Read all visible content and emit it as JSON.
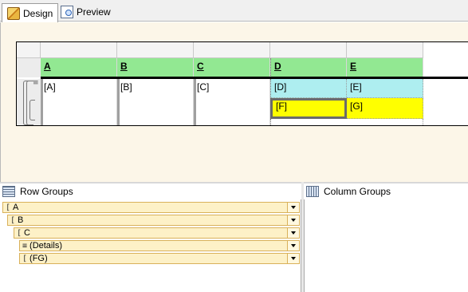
{
  "tabs": [
    {
      "label": "Design",
      "icon": "design-icon",
      "active": true
    },
    {
      "label": "Preview",
      "icon": "preview-icon",
      "active": false
    }
  ],
  "tablix": {
    "headers": [
      "A",
      "B",
      "C",
      "D",
      "E"
    ],
    "detail_row": [
      "[A]",
      "[B]",
      "[C]",
      "[D]",
      "[E]"
    ],
    "group_row": [
      "[F]",
      "[G]"
    ]
  },
  "row_groups": {
    "title": "Row Groups",
    "items": [
      {
        "label": "A",
        "icon": "["
      },
      {
        "label": "B",
        "icon": "["
      },
      {
        "label": "C",
        "icon": "["
      },
      {
        "label": "(Details)",
        "icon": "≡"
      },
      {
        "label": "(FG)",
        "icon": "["
      }
    ]
  },
  "column_groups": {
    "title": "Column Groups"
  },
  "colors": {
    "header_green": "#92e892",
    "cyan": "#aeeef0",
    "yellow": "#ffff00",
    "surface": "#fcf6e8",
    "group_bg": "#fdf1c7"
  }
}
